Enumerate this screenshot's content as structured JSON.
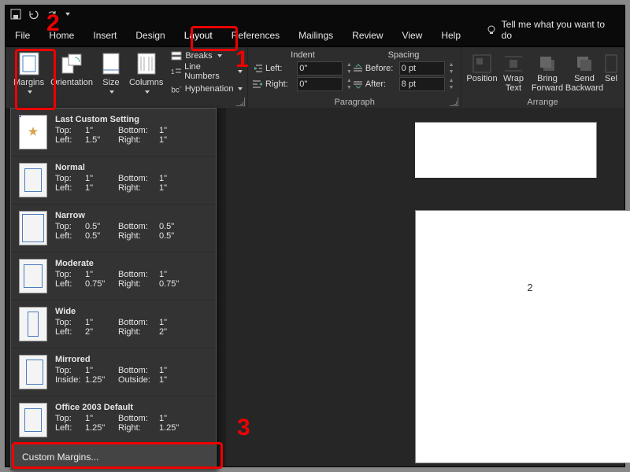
{
  "tabs": {
    "file": "File",
    "home": "Home",
    "insert": "Insert",
    "design": "Design",
    "layout": "Layout",
    "references": "References",
    "mailings": "Mailings",
    "review": "Review",
    "view": "View",
    "help": "Help",
    "tell": "Tell me what you want to do"
  },
  "ribbon": {
    "pageSetup": {
      "margins": "Margins",
      "orientation": "Orientation",
      "size": "Size",
      "columns": "Columns",
      "breaks": "Breaks",
      "lineNumbers": "Line Numbers",
      "hyphenation": "Hyphenation"
    },
    "paragraph": {
      "group": "Paragraph",
      "indent": "Indent",
      "spacing": "Spacing",
      "left": "Left:",
      "right": "Right:",
      "before": "Before:",
      "after": "After:",
      "leftVal": "0\"",
      "rightVal": "0\"",
      "beforeVal": "0 pt",
      "afterVal": "8 pt"
    },
    "arrange": {
      "group": "Arrange",
      "position": "Position",
      "wrap": "Wrap Text",
      "forward": "Bring Forward",
      "backward": "Send Backward",
      "sel": "Sel"
    }
  },
  "presets": [
    {
      "name": "Last Custom Setting",
      "tl": "Top:",
      "tv": "1\"",
      "bl": "Bottom:",
      "bv": "1\"",
      "ll": "Left:",
      "lv": "1.5\"",
      "rl": "Right:",
      "rv": "1\"",
      "ic": "star"
    },
    {
      "name": "Normal",
      "tl": "Top:",
      "tv": "1\"",
      "bl": "Bottom:",
      "bv": "1\"",
      "ll": "Left:",
      "lv": "1\"",
      "rl": "Right:",
      "rv": "1\"",
      "ic": "normal"
    },
    {
      "name": "Narrow",
      "tl": "Top:",
      "tv": "0.5\"",
      "bl": "Bottom:",
      "bv": "0.5\"",
      "ll": "Left:",
      "lv": "0.5\"",
      "rl": "Right:",
      "rv": "0.5\"",
      "ic": "narrow"
    },
    {
      "name": "Moderate",
      "tl": "Top:",
      "tv": "1\"",
      "bl": "Bottom:",
      "bv": "1\"",
      "ll": "Left:",
      "lv": "0.75\"",
      "rl": "Right:",
      "rv": "0.75\"",
      "ic": "moderate"
    },
    {
      "name": "Wide",
      "tl": "Top:",
      "tv": "1\"",
      "bl": "Bottom:",
      "bv": "1\"",
      "ll": "Left:",
      "lv": "2\"",
      "rl": "Right:",
      "rv": "2\"",
      "ic": "wide"
    },
    {
      "name": "Mirrored",
      "tl": "Top:",
      "tv": "1\"",
      "bl": "Bottom:",
      "bv": "1\"",
      "ll": "Inside:",
      "lv": "1.25\"",
      "rl": "Outside:",
      "rv": "1\"",
      "ic": "mirror"
    },
    {
      "name": "Office 2003 Default",
      "tl": "Top:",
      "tv": "1\"",
      "bl": "Bottom:",
      "bv": "1\"",
      "ll": "Left:",
      "lv": "1.25\"",
      "rl": "Right:",
      "rv": "1.25\"",
      "ic": "normal"
    }
  ],
  "custom": "Custom Margins...",
  "pageNum": "2",
  "anno": {
    "a1": "1",
    "a2": "2",
    "a3": "3"
  }
}
